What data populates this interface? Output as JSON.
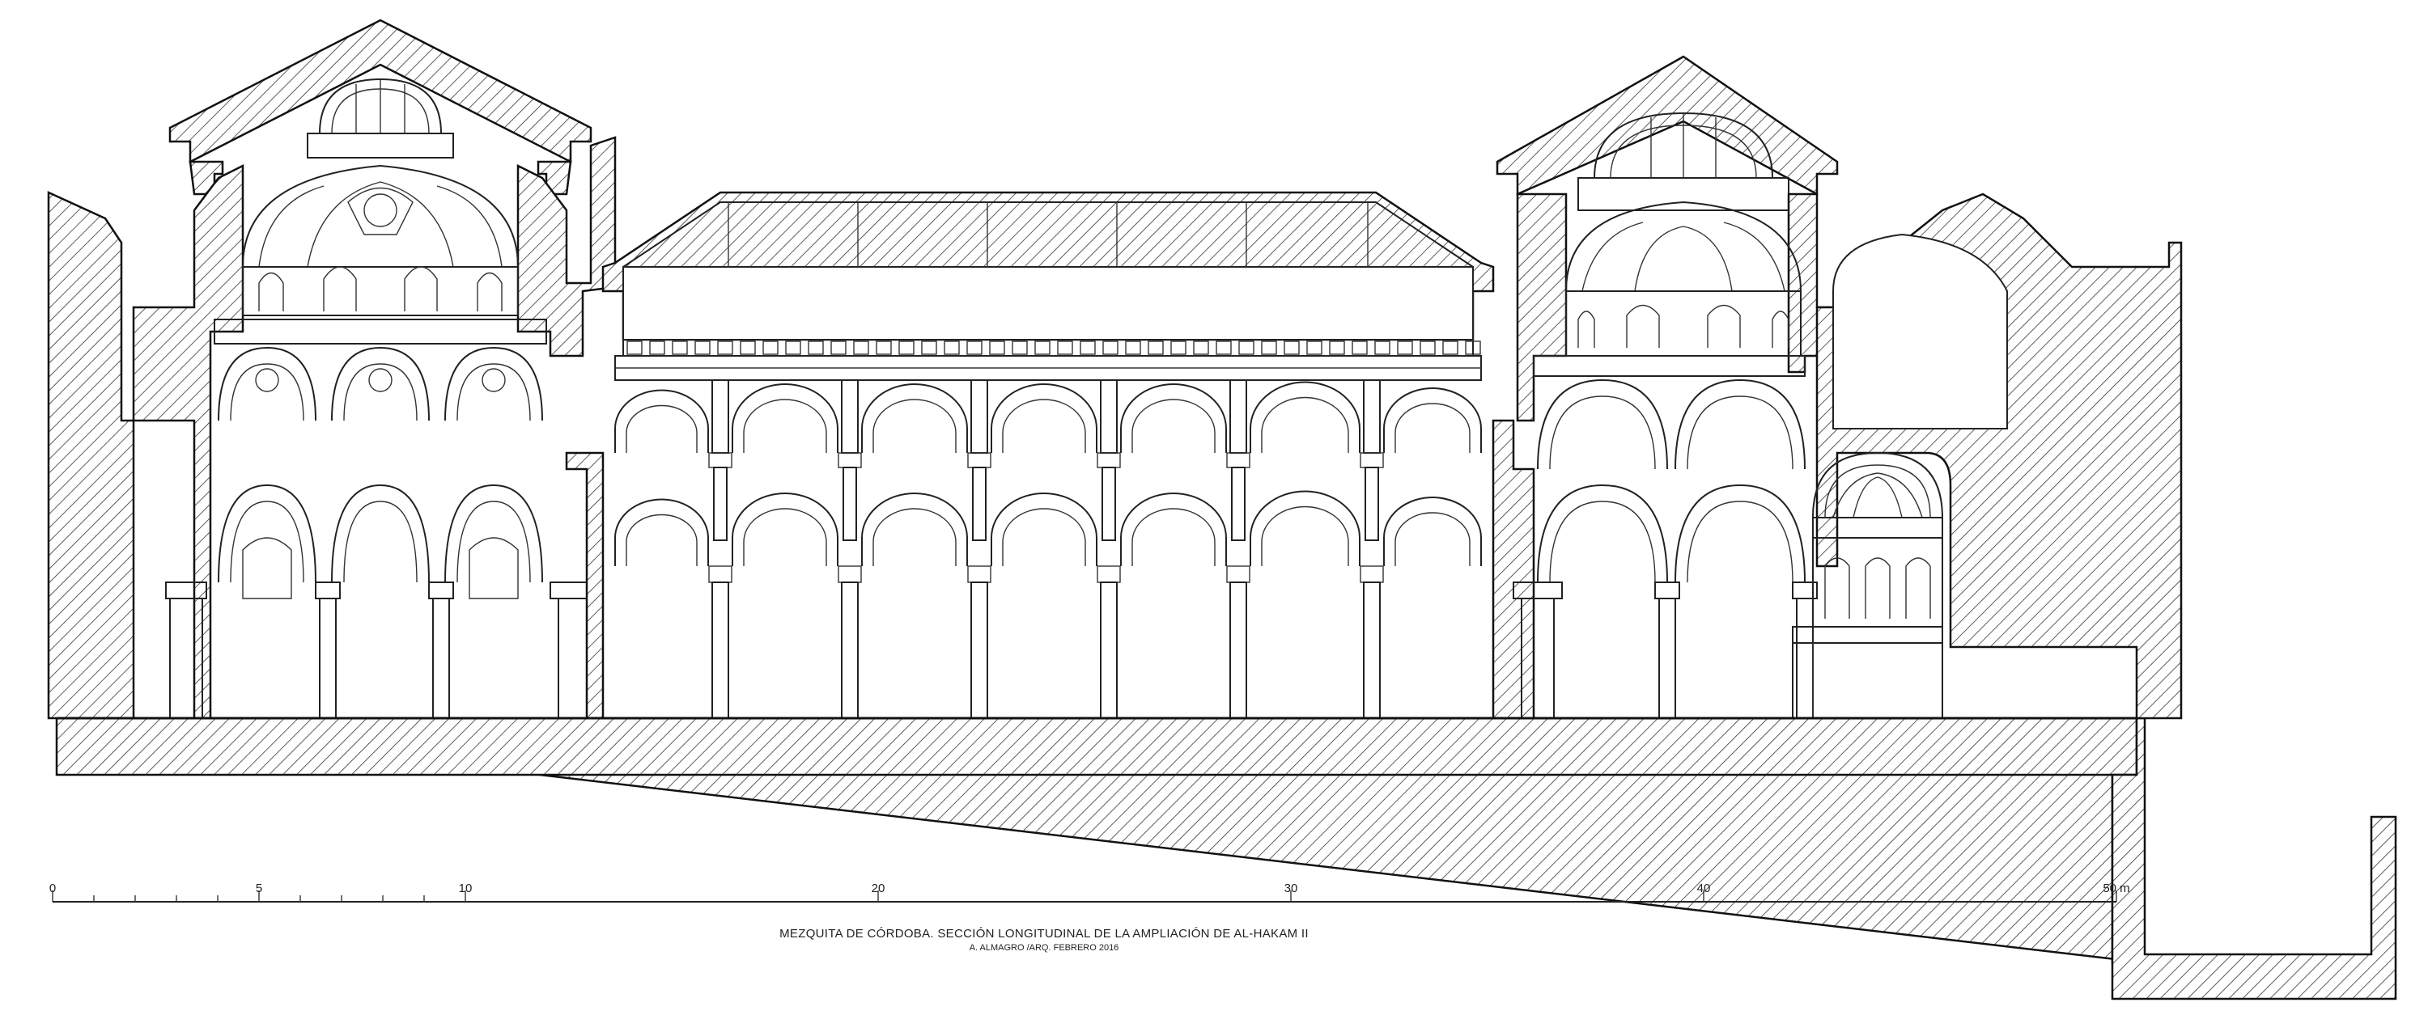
{
  "caption": {
    "title": "MEZQUITA DE CÓRDOBA. SECCIÓN LONGITUDINAL DE LA AMPLIACIÓN DE AL-HAKAM II",
    "credit": "A. ALMAGRO /ARQ. FEBRERO 2016"
  },
  "scale_bar": {
    "labels": [
      "0",
      "5",
      "10",
      "20",
      "30",
      "40",
      "50 m"
    ],
    "values": [
      0,
      5,
      10,
      20,
      30,
      40,
      50
    ],
    "unit": "m",
    "max": 50
  },
  "colors": {
    "ink": "#222222",
    "paper": "#ffffff"
  }
}
